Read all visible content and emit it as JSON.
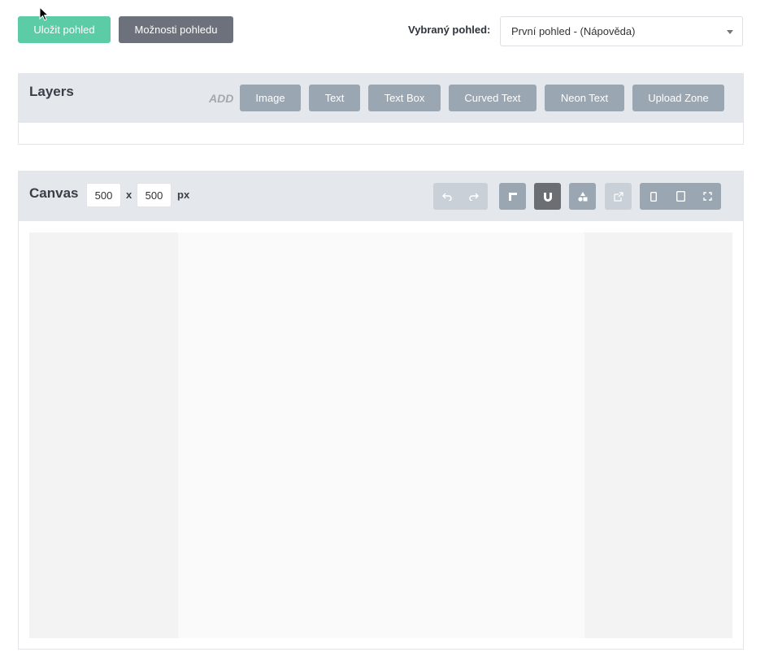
{
  "toolbar": {
    "save_label": "Uložit pohled",
    "options_label": "Možnosti pohledu",
    "view_label": "Vybraný pohled:",
    "view_selected": "První pohled - (Nápověda)"
  },
  "layers": {
    "title": "Layers",
    "add_label": "ADD",
    "buttons": [
      "Image",
      "Text",
      "Text Box",
      "Curved Text",
      "Neon Text",
      "Upload Zone"
    ]
  },
  "canvas": {
    "title": "Canvas",
    "width": "500",
    "separator": "x",
    "height": "500",
    "unit": "px",
    "tools": {
      "undo_icon": "undo-icon",
      "redo_icon": "redo-icon",
      "corner_icon": "corner-icon",
      "magnet_icon": "magnet-icon",
      "shapes_icon": "shapes-icon",
      "export_icon": "export-icon",
      "phone_icon": "phone-icon",
      "tablet_icon": "tablet-icon",
      "fullscreen_icon": "fullscreen-icon"
    }
  },
  "colors": {
    "save_button": "#5bcca6",
    "options_button": "#6c717c",
    "add_button": "#9aa6b2",
    "panel_header": "#e4e7eb",
    "active_tool": "#6b6e72"
  }
}
